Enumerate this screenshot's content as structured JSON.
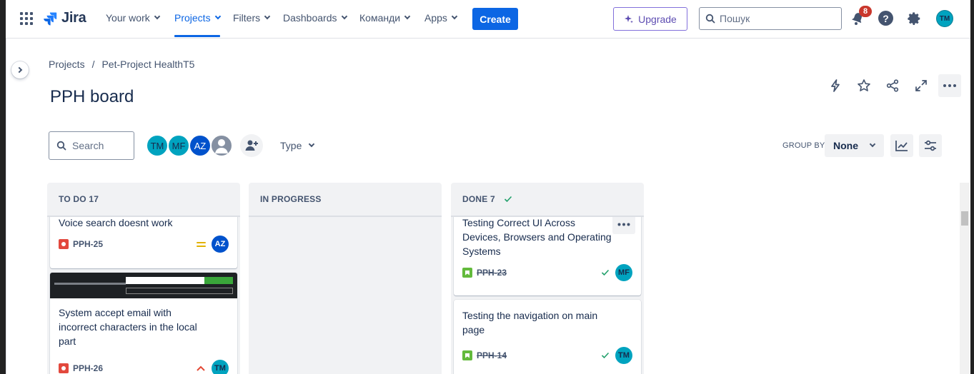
{
  "nav": {
    "logo": "Jira",
    "items": [
      {
        "label": "Your work"
      },
      {
        "label": "Projects"
      },
      {
        "label": "Filters"
      },
      {
        "label": "Dashboards"
      },
      {
        "label": "Команди"
      },
      {
        "label": "Apps"
      }
    ],
    "create": "Create",
    "upgrade": "Upgrade",
    "search_placeholder": "Пошук",
    "notifications": "8",
    "help": "?",
    "user_initials": "TM"
  },
  "breadcrumb": [
    "Projects",
    "/",
    "Pet-Project HealthT5"
  ],
  "title": "PPH board",
  "toolbar": {
    "search_placeholder": "Search",
    "avatars": [
      {
        "initials": "TM",
        "color": "#00a3bf"
      },
      {
        "initials": "MF",
        "color": "#00a3bf"
      },
      {
        "initials": "AZ",
        "color": "#0052cc"
      }
    ],
    "type_filter": "Type",
    "group_by_label": "GROUP BY",
    "group_by_value": "None"
  },
  "columns": [
    {
      "title": "TO DO 17",
      "cards": [
        {
          "title_lines": [
            "Voice search doesnt work"
          ],
          "key": "PPH-25",
          "assignee": "AZ"
        },
        {
          "title_lines": [
            "System accept email with",
            "incorrect characters in the local",
            "part"
          ],
          "key": "PPH-26",
          "assignee": "TM"
        }
      ]
    },
    {
      "title": "IN PROGRESS",
      "cards": []
    },
    {
      "title": "DONE 7",
      "cards": [
        {
          "title_lines": [
            "Testing Correct UI Across",
            "Devices, Browsers and Operating",
            "Systems"
          ],
          "key": "PPH-23",
          "assignee": "MF"
        },
        {
          "title_lines": [
            "Testing the navigation on main",
            "page"
          ],
          "key": "PPH-14",
          "assignee": "TM"
        }
      ]
    }
  ],
  "colors": {
    "primary": "#0c66e4",
    "bug": "#e2483d",
    "story": "#63ba3c",
    "upgrade": "#8270db",
    "done_check": "#22a06b"
  }
}
